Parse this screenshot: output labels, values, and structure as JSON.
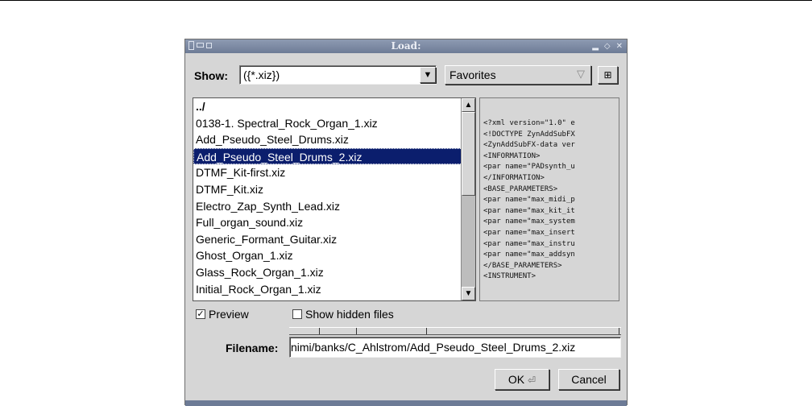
{
  "window": {
    "title": "Load:"
  },
  "show": {
    "label": "Show:",
    "value": "({*.xiz})"
  },
  "favorites": {
    "label": "Favorites"
  },
  "files": [
    {
      "name": "../"
    },
    {
      "name": "0138-1. Spectral_Rock_Organ_1.xiz"
    },
    {
      "name": "Add_Pseudo_Steel_Drums.xiz"
    },
    {
      "name": "Add_Pseudo_Steel_Drums_2.xiz"
    },
    {
      "name": "DTMF_Kit-first.xiz"
    },
    {
      "name": "DTMF_Kit.xiz"
    },
    {
      "name": "Electro_Zap_Synth_Lead.xiz"
    },
    {
      "name": "Full_organ_sound.xiz"
    },
    {
      "name": "Generic_Formant_Guitar.xiz"
    },
    {
      "name": "Ghost_Organ_1.xiz"
    },
    {
      "name": "Glass_Rock_Organ_1.xiz"
    },
    {
      "name": "Initial_Rock_Organ_1.xiz"
    }
  ],
  "selected_file": "Add_Pseudo_Steel_Drums_2.xiz",
  "preview_lines": [
    "<?xml version=\"1.0\" e",
    "<!DOCTYPE ZynAddSubFX",
    "<ZynAddSubFX-data ver",
    "<INFORMATION>",
    "<par name=\"PADsynth_u",
    "</INFORMATION>",
    "<BASE_PARAMETERS>",
    "<par name=\"max_midi_p",
    "<par name=\"max_kit_it",
    "<par name=\"max_system",
    "<par name=\"max_insert",
    "<par name=\"max_instru",
    "<par name=\"max_addsyn",
    "</BASE_PARAMETERS>",
    "<INSTRUMENT>"
  ],
  "options": {
    "preview_label": "Preview",
    "preview_checked": true,
    "hidden_label": "Show hidden files",
    "hidden_checked": false
  },
  "filename": {
    "label": "Filename:",
    "value": "nimi/banks/C_Ahlstrom/Add_Pseudo_Steel_Drums_2.xiz"
  },
  "buttons": {
    "ok": "OK",
    "cancel": "Cancel"
  }
}
